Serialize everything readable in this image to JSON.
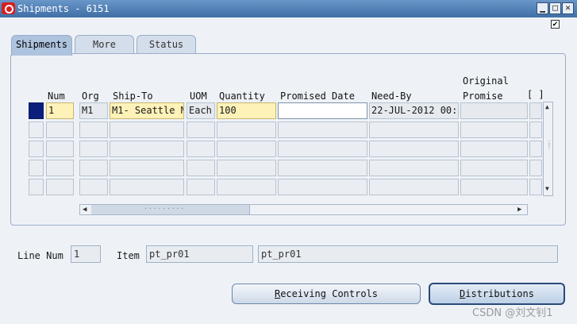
{
  "window": {
    "title": "Shipments - 6151",
    "minimize_label": "▁",
    "maximize_label": "□",
    "close_label": "✕",
    "corner_check": "✔"
  },
  "tabs": [
    {
      "label": "Shipments",
      "active": true
    },
    {
      "label": "More",
      "active": false
    },
    {
      "label": "Status",
      "active": false
    }
  ],
  "table": {
    "headers": {
      "num": "Num",
      "org": "Org",
      "ship_to": "Ship-To",
      "uom": "UOM",
      "quantity": "Quantity",
      "promised_date": "Promised Date",
      "need_by": "Need-By",
      "original_promise_line1": "Original",
      "original_promise_line2": "Promise",
      "more": "[ ]"
    },
    "rows": [
      {
        "num": "1",
        "org": "M1",
        "ship_to": "M1- Seattle M",
        "uom": "Each",
        "quantity": "100",
        "promised_date": "",
        "need_by": "22-JUL-2012 00:0",
        "original_promise": ""
      }
    ]
  },
  "footer": {
    "line_num_label": "Line Num",
    "line_num_value": "1",
    "item_label": "Item",
    "item_value": "pt_pr01",
    "item_description": "pt_pr01"
  },
  "buttons": {
    "receiving_controls": {
      "mnemonic": "R",
      "rest": "eceiving Controls"
    },
    "distributions": {
      "mnemonic": "D",
      "rest": "istributions"
    }
  },
  "watermark": "CSDN @刘文钊1"
}
